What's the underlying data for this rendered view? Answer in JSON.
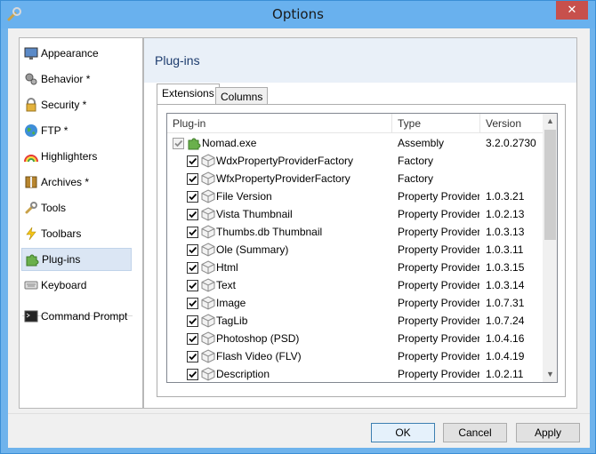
{
  "window": {
    "title": "Options",
    "close_label": "✕"
  },
  "sidebar": {
    "items": [
      {
        "label": "Appearance",
        "icon": "monitor-icon"
      },
      {
        "label": "Behavior *",
        "icon": "gears-icon"
      },
      {
        "label": "Security *",
        "icon": "lock-icon"
      },
      {
        "label": "FTP *",
        "icon": "globe-icon"
      },
      {
        "label": "Highlighters",
        "icon": "rainbow-icon"
      },
      {
        "label": "Archives *",
        "icon": "archive-icon"
      },
      {
        "label": "Tools",
        "icon": "wrench-icon"
      },
      {
        "label": "Toolbars",
        "icon": "lightning-icon"
      },
      {
        "label": "Plug-ins",
        "icon": "puzzle-icon",
        "selected": true
      },
      {
        "label": "Keyboard",
        "icon": "keyboard-icon"
      },
      {
        "label": "Command Prompt",
        "icon": "console-icon"
      }
    ]
  },
  "content": {
    "title": "Plug-ins",
    "tabs": [
      {
        "label": "Extensions",
        "active": true
      },
      {
        "label": "Columns",
        "active": false
      }
    ]
  },
  "table": {
    "columns": [
      "Plug-in",
      "Type",
      "Version"
    ],
    "rows": [
      {
        "name": "Nomad.exe",
        "type": "Assembly",
        "version": "3.2.0.2730",
        "checked": true,
        "root": true
      },
      {
        "name": "WdxPropertyProviderFactory",
        "type": "Factory",
        "version": "",
        "checked": true
      },
      {
        "name": "WfxPropertyProviderFactory",
        "type": "Factory",
        "version": "",
        "checked": true
      },
      {
        "name": "File Version",
        "type": "Property Provider",
        "version": "1.0.3.21",
        "checked": true
      },
      {
        "name": "Vista Thumbnail",
        "type": "Property Provider",
        "version": "1.0.2.13",
        "checked": true
      },
      {
        "name": "Thumbs.db Thumbnail",
        "type": "Property Provider",
        "version": "1.0.3.13",
        "checked": true
      },
      {
        "name": "Ole (Summary)",
        "type": "Property Provider",
        "version": "1.0.3.11",
        "checked": true
      },
      {
        "name": "Html",
        "type": "Property Provider",
        "version": "1.0.3.15",
        "checked": true
      },
      {
        "name": "Text",
        "type": "Property Provider",
        "version": "1.0.3.14",
        "checked": true
      },
      {
        "name": "Image",
        "type": "Property Provider",
        "version": "1.0.7.31",
        "checked": true
      },
      {
        "name": "TagLib",
        "type": "Property Provider",
        "version": "1.0.7.24",
        "checked": true
      },
      {
        "name": "Photoshop (PSD)",
        "type": "Property Provider",
        "version": "1.0.4.16",
        "checked": true
      },
      {
        "name": "Flash Video (FLV)",
        "type": "Property Provider",
        "version": "1.0.4.19",
        "checked": true
      },
      {
        "name": "Description",
        "type": "Property Provider",
        "version": "1.0.2.11",
        "checked": true
      }
    ]
  },
  "scroll": {
    "up": "▲",
    "down": "▼"
  },
  "buttons": {
    "ok": "OK",
    "cancel": "Cancel",
    "apply": "Apply"
  }
}
